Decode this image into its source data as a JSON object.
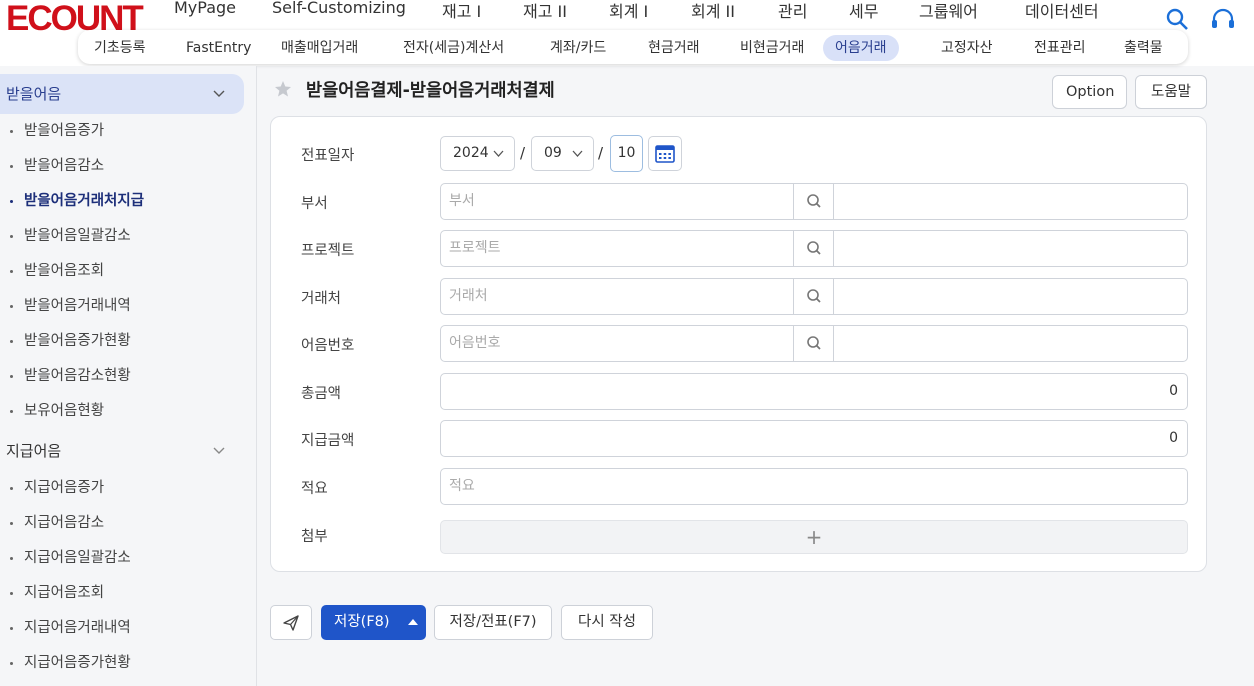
{
  "header": {
    "logo_text": "ECOUNT",
    "top_menu": [
      "MyPage",
      "Self-Customizing",
      "재고 I",
      "재고 II",
      "회계 I",
      "회계 II",
      "관리",
      "세무",
      "그룹웨어",
      "데이터센터"
    ],
    "active_top_menu": "회계 I",
    "sub_menu": [
      "기초등록",
      "FastEntry",
      "매출매입거래",
      "전자(세금)계산서",
      "계좌/카드",
      "현금거래",
      "비현금거래",
      "어음거래",
      "고정자산",
      "전표관리",
      "출력물"
    ],
    "active_sub_menu": "어음거래",
    "icons": [
      "search-icon",
      "headset-icon"
    ]
  },
  "sidebar": {
    "group1": {
      "title": "받을어음",
      "items": [
        "받을어음증가",
        "받을어음감소",
        "받을어음거래처지급",
        "받을어음일괄감소",
        "받을어음조회",
        "받을어음거래내역",
        "받을어음증가현황",
        "받을어음감소현황",
        "보유어음현황"
      ],
      "active_item": "받을어음거래처지급"
    },
    "group2": {
      "title": "지급어음",
      "items": [
        "지급어음증가",
        "지급어음감소",
        "지급어음일괄감소",
        "지급어음조회",
        "지급어음거래내역",
        "지급어음증가현황"
      ]
    }
  },
  "page": {
    "title": "받을어음결제-받을어음거래처결제",
    "option_label": "Option",
    "help_label": "도움말"
  },
  "form": {
    "date_label": "전표일자",
    "year": "2024",
    "month": "09",
    "day": "10",
    "date_sep": "/",
    "dept_label": "부서",
    "dept_placeholder": "부서",
    "project_label": "프로젝트",
    "project_placeholder": "프로젝트",
    "vendor_label": "거래처",
    "vendor_placeholder": "거래처",
    "bill_label": "어음번호",
    "bill_placeholder": "어음번호",
    "total_label": "총금액",
    "total_value": "0",
    "pay_label": "지급금액",
    "pay_value": "0",
    "memo_label": "적요",
    "memo_placeholder": "적요",
    "attach_label": "첨부",
    "attach_plus": "+"
  },
  "footer": {
    "save_label": "저장(F8)",
    "save_slip_label": "저장/전표(F7)",
    "rewrite_label": "다시 작성"
  },
  "colors": {
    "primary": "#1f55c9",
    "logo_red": "#d0101a",
    "active_pill": "#d9e1f8",
    "active_text": "#1d2f7a",
    "icon_blue": "#1b6fd8"
  }
}
